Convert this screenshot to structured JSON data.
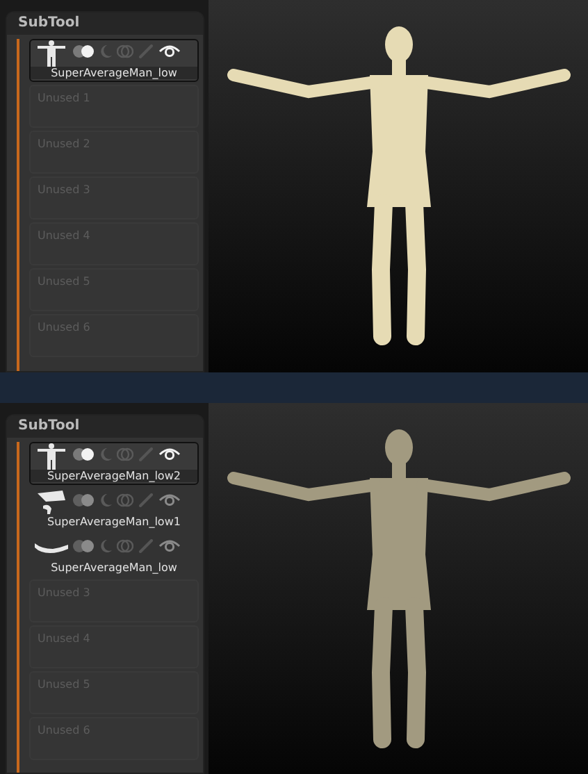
{
  "screens": [
    {
      "panel": {
        "title": "SubTool",
        "items": [
          {
            "kind": "figure",
            "name": "SuperAverageMan_low",
            "selected": true
          },
          {
            "kind": "unused",
            "label": "Unused  1"
          },
          {
            "kind": "unused",
            "label": "Unused  2"
          },
          {
            "kind": "unused",
            "label": "Unused  3"
          },
          {
            "kind": "unused",
            "label": "Unused  4"
          },
          {
            "kind": "unused",
            "label": "Unused  5"
          },
          {
            "kind": "unused",
            "label": "Unused  6"
          }
        ]
      },
      "viewport": {
        "dimmed": false
      }
    },
    {
      "panel": {
        "title": "SubTool",
        "items": [
          {
            "kind": "figure",
            "name": "SuperAverageMan_low2",
            "selected": true
          },
          {
            "kind": "part",
            "name": "SuperAverageMan_low1",
            "selected": false
          },
          {
            "kind": "limb",
            "name": "SuperAverageMan_low",
            "selected": false
          },
          {
            "kind": "unused",
            "label": "Unused  3"
          },
          {
            "kind": "unused",
            "label": "Unused  4"
          },
          {
            "kind": "unused",
            "label": "Unused  5"
          },
          {
            "kind": "unused",
            "label": "Unused  6"
          }
        ]
      },
      "viewport": {
        "dimmed": true
      }
    }
  ]
}
